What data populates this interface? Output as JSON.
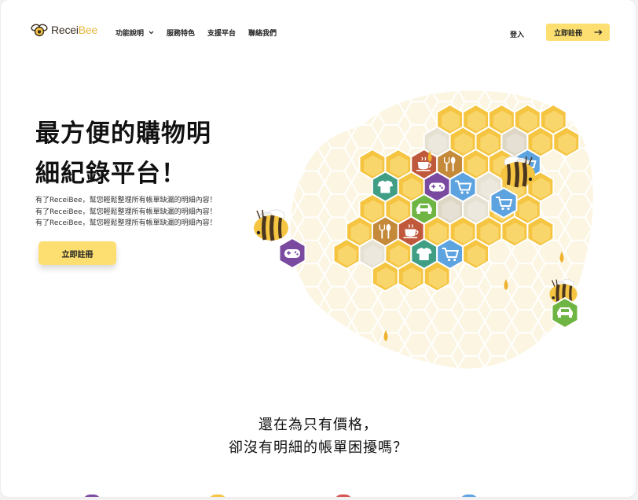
{
  "brand": {
    "logo_main": "Recei",
    "logo_accent": "Bee",
    "accent_color": "#fcdf70",
    "honey_color": "#f5c542"
  },
  "nav": {
    "items": [
      {
        "label": "功能說明",
        "has_dropdown": true
      },
      {
        "label": "服務特色",
        "has_dropdown": false
      },
      {
        "label": "支援平台",
        "has_dropdown": false
      },
      {
        "label": "聯絡我們",
        "has_dropdown": false
      }
    ],
    "login_label": "登入",
    "cta_label": "立即註冊",
    "cta_icon": "arrow-right-icon"
  },
  "hero": {
    "title_line1": "最方便的購物明",
    "title_line2": "細紀錄平台！",
    "desc_lines": [
      "有了ReceiBee，幫您輕鬆整理所有帳單缺漏的明細內容！",
      "有了ReceiBee，幫您輕鬆整理所有帳單缺漏的明細內容！",
      "有了ReceiBee，幫您輕鬆整理所有帳單缺漏的明細內容！"
    ],
    "cta_label": "立即註冊"
  },
  "illustration": {
    "icons": [
      "shirt-icon",
      "gamepad-icon",
      "cart-icon",
      "coffee-icon",
      "cutlery-icon",
      "car-icon"
    ],
    "colors": {
      "shirt": "#3f9e84",
      "game": "#7a4aa0",
      "cart": "#5da3e0",
      "coffee": "#c0593b",
      "cutlery": "#c48a3a",
      "car": "#6fb544"
    }
  },
  "section2": {
    "line1": "還在為只有價格，",
    "line2": "卻沒有明細的帳單困擾嗎？"
  }
}
